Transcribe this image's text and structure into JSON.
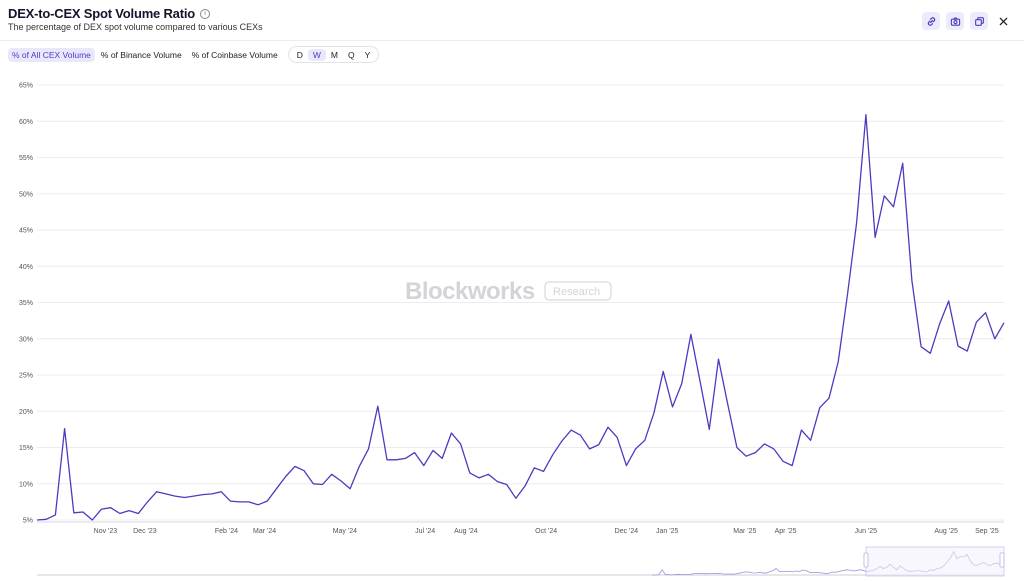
{
  "header": {
    "title": "DEX-to-CEX Spot Volume Ratio",
    "subtitle": "The percentage of DEX spot volume compared to various CEXs",
    "info_glyph": "i"
  },
  "toolbar": {
    "tabs": [
      {
        "label": "% of All CEX Volume",
        "active": true
      },
      {
        "label": "% of Binance Volume",
        "active": false
      },
      {
        "label": "% of Coinbase Volume",
        "active": false
      }
    ],
    "timeframes": [
      {
        "label": "D",
        "active": false
      },
      {
        "label": "W",
        "active": true
      },
      {
        "label": "M",
        "active": false
      },
      {
        "label": "Q",
        "active": false
      },
      {
        "label": "Y",
        "active": false
      }
    ]
  },
  "actions": [
    "link-icon",
    "camera-icon",
    "copy-icon",
    "close-icon"
  ],
  "watermark": {
    "brand": "Blockworks",
    "badge": "Research"
  },
  "colors": {
    "line": "#4b3bbf",
    "grid": "#ececf0",
    "accent": "#e9e8fb"
  },
  "chart_data": {
    "type": "line",
    "x_start": "2023-09-10",
    "x_interval_days": 7,
    "ylim": [
      5,
      65
    ],
    "y_ticks": [
      5,
      10,
      15,
      20,
      25,
      30,
      35,
      40,
      45,
      50,
      55,
      60,
      65
    ],
    "y_tick_format": "{v}%",
    "x_ticks": [
      {
        "label": "Nov '23",
        "date": "2023-11-01"
      },
      {
        "label": "Dec '23",
        "date": "2023-12-01"
      },
      {
        "label": "Feb '24",
        "date": "2024-02-01"
      },
      {
        "label": "Mar '24",
        "date": "2024-03-01"
      },
      {
        "label": "May '24",
        "date": "2024-05-01"
      },
      {
        "label": "Jul '24",
        "date": "2024-07-01"
      },
      {
        "label": "Aug '24",
        "date": "2024-08-01"
      },
      {
        "label": "Oct '24",
        "date": "2024-10-01"
      },
      {
        "label": "Dec '24",
        "date": "2024-12-01"
      },
      {
        "label": "Jan '25",
        "date": "2025-01-01"
      },
      {
        "label": "Mar '25",
        "date": "2025-03-01"
      },
      {
        "label": "Apr '25",
        "date": "2025-04-01"
      },
      {
        "label": "Jun '25",
        "date": "2025-06-01"
      },
      {
        "label": "Aug '25",
        "date": "2025-08-01"
      },
      {
        "label": "Sep '25",
        "date": "2025-09-01"
      }
    ],
    "series": [
      {
        "name": "% of All CEX Volume",
        "values": [
          5.0,
          5.1,
          5.7,
          17.6,
          6.0,
          6.1,
          5.0,
          6.5,
          6.7,
          5.9,
          6.3,
          5.9,
          7.5,
          8.9,
          8.6,
          8.3,
          8.1,
          8.3,
          8.5,
          8.6,
          8.9,
          7.6,
          7.5,
          7.5,
          7.1,
          7.6,
          9.3,
          11.0,
          12.4,
          11.8,
          10.0,
          9.9,
          11.3,
          10.4,
          9.3,
          12.4,
          14.8,
          20.7,
          13.3,
          13.3,
          13.5,
          14.3,
          12.5,
          14.6,
          13.5,
          17.0,
          15.5,
          11.5,
          10.8,
          11.3,
          10.3,
          9.9,
          8.0,
          9.7,
          12.2,
          11.7,
          14.0,
          15.9,
          17.4,
          16.7,
          14.8,
          15.4,
          17.8,
          16.4,
          12.5,
          14.8,
          16.0,
          19.8,
          25.5,
          20.6,
          23.8,
          30.6,
          24.1,
          17.5,
          27.2,
          21.0,
          15.0,
          13.8,
          14.3,
          15.5,
          14.8,
          13.1,
          12.5,
          17.4,
          16.0,
          20.5,
          21.8,
          26.8,
          36.0,
          46.0,
          60.9,
          44.0,
          49.7,
          48.2,
          54.2,
          38.0,
          28.9,
          28.0,
          32.0,
          35.2,
          29.0,
          28.3,
          32.3,
          33.6,
          30.0,
          32.2
        ]
      }
    ]
  }
}
